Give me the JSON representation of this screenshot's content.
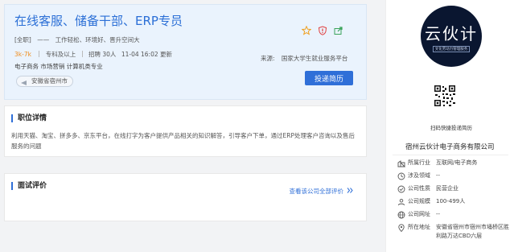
{
  "job": {
    "title": "在线客服、储备干部、ERP专员",
    "type_tag": "[全职]",
    "dash": "——",
    "tags": [
      "工作轻松、环境好、晋升空间大"
    ],
    "salary": "3k-7k",
    "education": "专科及以上",
    "hiring": "招聘 30人",
    "updated": "11-04 16:02 更新",
    "categories": "电子商务  市场营销  计算机类专业",
    "location": "安徽省宿州市",
    "source_label": "来源:",
    "source_value": "国家大学生就业服务平台",
    "apply_label": "投递简历",
    "icons": [
      "star-icon",
      "shield-icon",
      "share-icon"
    ],
    "colors": {
      "accent": "#2f6fd8",
      "salary": "#f08c1a"
    }
  },
  "detail": {
    "heading": "职位详情",
    "text": "利用天猫、淘宝、拼多多、京东平台，在线打字为客户提供产品相关的知识解答，引导客户下单，通过ERP处理客户咨询以及售后服务的问题"
  },
  "review": {
    "heading": "面试评价",
    "link": "查看该公司全部评价"
  },
  "company": {
    "logo_text": "云伙计",
    "logo_sub": "文化劳动力管理服务",
    "qr_caption": "扫码快捷投递简历",
    "name": "宿州云伙计电子商务有限公司",
    "info": [
      {
        "icon": "industry-icon",
        "label": "所属行业",
        "value": "互联网/电子商务"
      },
      {
        "icon": "domain-icon",
        "label": "涉及领域",
        "value": "--"
      },
      {
        "icon": "nature-icon",
        "label": "公司性质",
        "value": "民营企业"
      },
      {
        "icon": "size-icon",
        "label": "公司规模",
        "value": "100-499人"
      },
      {
        "icon": "website-icon",
        "label": "公司网址",
        "value": "--"
      },
      {
        "icon": "address-icon",
        "label": "所在地址",
        "value": "安徽省宿州市宿州市埇桥区胜利路万达CBD六层"
      }
    ]
  }
}
